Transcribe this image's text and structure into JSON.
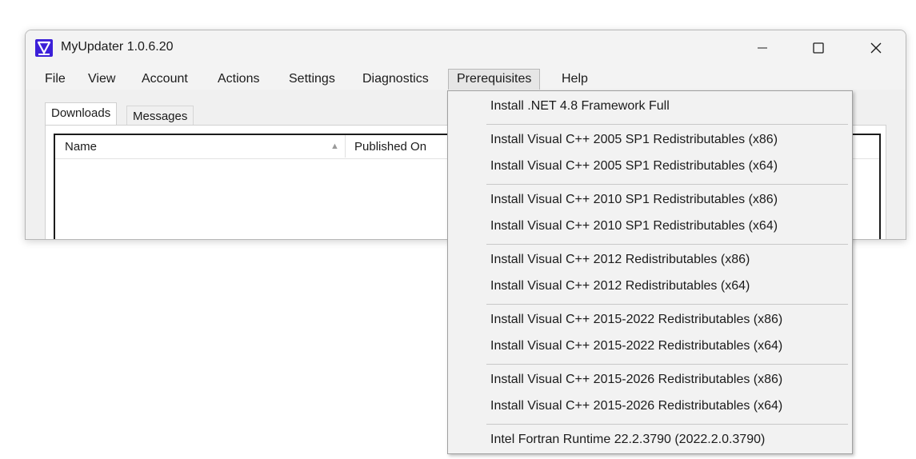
{
  "window": {
    "title": "MyUpdater 1.0.6.20"
  },
  "menubar": {
    "items": [
      "File",
      "View",
      "Account",
      "Actions",
      "Settings",
      "Diagnostics",
      "Prerequisites",
      "Help"
    ],
    "active": "Prerequisites"
  },
  "tabs": {
    "downloads": "Downloads",
    "messages": "Messages"
  },
  "list": {
    "columns": [
      "Name",
      "Published On"
    ],
    "sort_indicator": "▲"
  },
  "dropdown": {
    "items": [
      "Install .NET 4.8 Framework Full",
      "Install Visual C++ 2005 SP1 Redistributables (x86)",
      "Install Visual C++ 2005 SP1 Redistributables (x64)",
      "Install Visual C++ 2010 SP1 Redistributables (x86)",
      "Install Visual C++ 2010 SP1 Redistributables (x64)",
      "Install Visual C++ 2012 Redistributables (x86)",
      "Install Visual C++ 2012 Redistributables (x64)",
      "Install Visual C++ 2015-2022 Redistributables (x86)",
      "Install Visual C++ 2015-2022 Redistributables (x64)",
      "Install Visual C++ 2015-2026 Redistributables (x86)",
      "Install Visual C++ 2015-2026 Redistributables (x64)",
      "Intel Fortran Runtime 22.2.3790 (2022.2.0.3790)"
    ]
  },
  "colors": {
    "app_icon": "#3b1fd8",
    "menu_bg": "#f2f2f2",
    "window_bg": "#f0f0f0"
  }
}
